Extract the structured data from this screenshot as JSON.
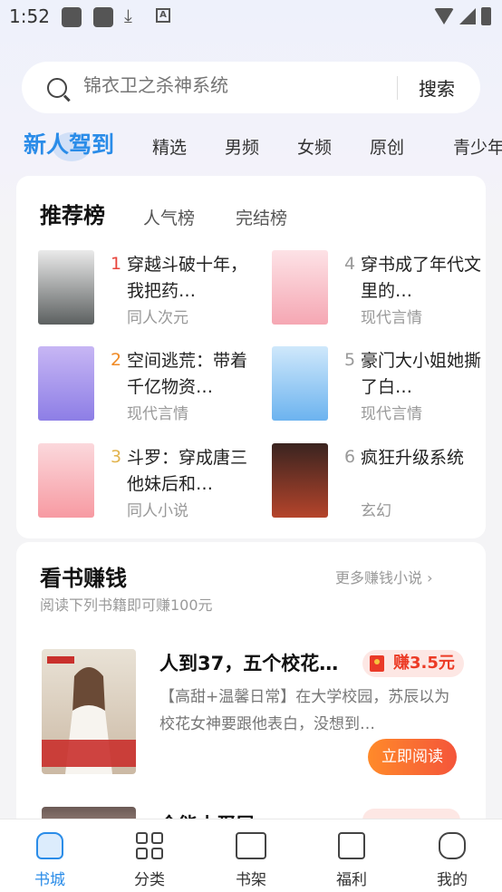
{
  "status_bar": {
    "time": "1:52"
  },
  "search": {
    "placeholder": "锦衣卫之杀神系统",
    "button": "搜索"
  },
  "tabs": {
    "active": "新人驾到",
    "items": [
      "精选",
      "男频",
      "女频",
      "原创",
      "青少年"
    ]
  },
  "ranking": {
    "tabs": [
      "推荐榜",
      "人气榜",
      "完结榜"
    ],
    "books": [
      {
        "rank": "1",
        "title": "穿越斗破十年，我把药…",
        "category": "同人次元",
        "rank_color": "#e8453c",
        "cover": [
          "#eaeaea",
          "#5c6060"
        ]
      },
      {
        "rank": "2",
        "title": "空间逃荒：带着千亿物资…",
        "category": "现代言情",
        "rank_color": "#f08a24",
        "cover": [
          "#c7b6f4",
          "#8d7ee6"
        ]
      },
      {
        "rank": "3",
        "title": "斗罗：穿成唐三他妹后和…",
        "category": "同人小说",
        "rank_color": "#e2b44f",
        "cover": [
          "#fbd8dc",
          "#f79aa2"
        ]
      },
      {
        "rank": "4",
        "title": "穿书成了年代文里的…",
        "category": "现代言情",
        "rank_color": "#999999",
        "cover": [
          "#fde2e6",
          "#f5a7b3"
        ]
      },
      {
        "rank": "5",
        "title": "豪门大小姐她撕了白…",
        "category": "现代言情",
        "rank_color": "#999999",
        "cover": [
          "#cfe8fb",
          "#6cb3ef"
        ]
      },
      {
        "rank": "6",
        "title": "疯狂升级系统",
        "category": "玄幻",
        "rank_color": "#999999",
        "cover": [
          "#3a2420",
          "#b5442b"
        ]
      }
    ]
  },
  "earn": {
    "title": "看书赚钱",
    "more": "更多赚钱小说",
    "subtitle": "阅读下列书籍即可赚100元",
    "books": [
      {
        "title": "人到37，五个校花…",
        "reward": "赚3.5元",
        "description": "【高甜+温馨日常】在大学校园，苏辰以为校花女神要跟他表白，没想到…",
        "button": "立即阅读"
      },
      {
        "title": "全能小蛋层"
      }
    ]
  },
  "bottom_nav": [
    {
      "label": "书城",
      "icon": "home-icon",
      "active": true
    },
    {
      "label": "分类",
      "icon": "grid-icon",
      "active": false
    },
    {
      "label": "书架",
      "icon": "book-icon",
      "active": false
    },
    {
      "label": "福利",
      "icon": "gift-icon",
      "active": false
    },
    {
      "label": "我的",
      "icon": "profile-icon",
      "active": false
    }
  ]
}
